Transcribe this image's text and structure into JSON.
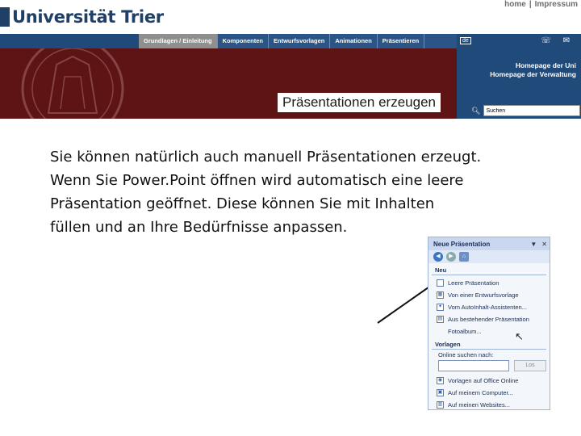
{
  "header": {
    "logo_text": "Universität Trier",
    "toplinks": [
      "home",
      "|",
      "Impressum"
    ],
    "nav": [
      "Grundlagen / Einleitung",
      "Komponenten",
      "Entwurfsvorlagen",
      "Animationen",
      "Präsentieren"
    ],
    "active_nav_index": 0,
    "lang_badge": "de",
    "right_links": [
      "Homepage der Uni",
      "Homepage der Verwaltung"
    ],
    "search_value": "Suchen",
    "banner_title": "Präsentationen erzeugen"
  },
  "body_lines": [
    "Sie können natürlich auch manuell Präsentationen erzeugt.",
    "Wenn Sie Power.Point öffnen wird automatisch eine leere",
    "Präsentation geöffnet. Diese können Sie mit Inhalten",
    "füllen und an Ihre Bedürfnisse anpassen."
  ],
  "task_pane": {
    "title": "Neue Präsentation",
    "section_new": "Neu",
    "new_items": [
      "Leere Präsentation",
      "Von einer Entwurfsvorlage",
      "Vom AutoInhalt-Assistenten...",
      "Aus bestehender Präsentation",
      "Fotoalbum..."
    ],
    "section_templates": "Vorlagen",
    "search_label": "Online suchen nach:",
    "go_button": "Los",
    "template_items": [
      "Vorlagen auf Office Online",
      "Auf meinem Computer...",
      "Auf meinen Websites..."
    ]
  },
  "colors": {
    "banner": "#5e1414",
    "nav_blue": "#2a5586",
    "logo_blue": "#1f3f66"
  }
}
